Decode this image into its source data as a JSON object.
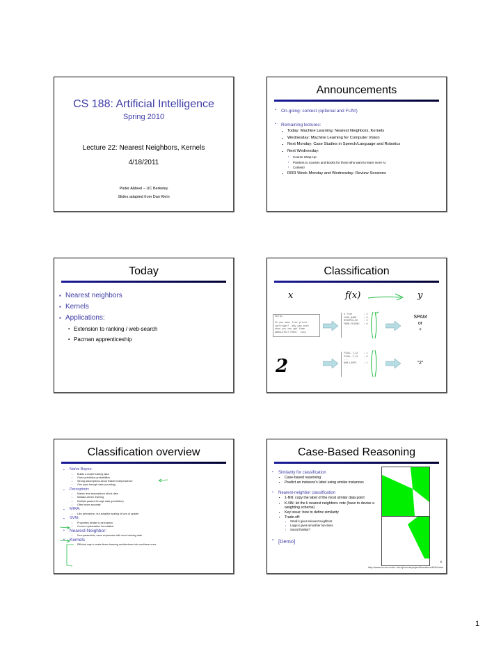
{
  "page_number": "1",
  "colors": {
    "title_blue": "#3c3ca6",
    "rule_start": "#1a1a9a",
    "rule_end": "#000030",
    "annotation_green": "#22bb44",
    "knn_green": "#00ee00",
    "arrow_fill": "#b5dde3"
  },
  "slides": [
    {
      "id": "title-slide",
      "course": "CS 188: Artificial Intelligence",
      "term": "Spring 2010",
      "lecture": "Lecture 22: Nearest Neighbors, Kernels",
      "date": "4/18/2011",
      "author": "Pieter Abbeel – UC Berkeley",
      "credit": "Slides adapted from Dan Klein"
    },
    {
      "id": "announcements",
      "title": "Announcements",
      "items": [
        {
          "text": "On-going: contest (optional and FUN!)"
        },
        {
          "text": "Remaining lectures:",
          "children": [
            {
              "text": "Today: Machine Learning: Nearest Neighbors, Kernels"
            },
            {
              "text": "Wednesday: Machine Learning for Computer Vision"
            },
            {
              "text": "Next Monday: Case Studies in Speech/Language and Robotics"
            },
            {
              "text": "Next Wednesday:",
              "children": [
                {
                  "text": "Course Wrap-Up"
                },
                {
                  "text": "Pointers to courses and Books for those who want to learn more AI"
                },
                {
                  "text": "Contest!"
                }
              ]
            },
            {
              "text": "RRR Week Monday and Wednesday: Review Sessions"
            }
          ]
        }
      ]
    },
    {
      "id": "today",
      "title": "Today",
      "items": [
        {
          "text": "Nearest neighbors"
        },
        {
          "text": "Kernels"
        },
        {
          "text": "Applications:",
          "children": [
            {
              "text": "Extension to ranking / web-search"
            },
            {
              "text": "Pacman apprenticeship"
            }
          ]
        }
      ]
    },
    {
      "id": "classification",
      "title": "Classification",
      "headers": {
        "x": "x",
        "fx": "f(x)",
        "y": "y"
      },
      "email_text": [
        "Hello,",
        "",
        "Do you want free printr",
        "cartriges?  Why pay more",
        "when you can get them",
        "ABSOLUTELY FREE!  Just"
      ],
      "email_features": [
        "# free        : 2",
        "YOUR_NAME     : 0",
        "MISSPELLED    : 2",
        "FROM_FRIEND   : 0",
        "..."
      ],
      "email_output": [
        "SPAM",
        "or",
        "+"
      ],
      "digit": "2",
      "digit_features": [
        "PIXEL-7,12    : 1",
        "PIXEL-7,13    : 0",
        "...",
        "NUM_LOOPS     : 1",
        "..."
      ],
      "digit_output": "“2”"
    },
    {
      "id": "classification-overview",
      "title": "Classification overview",
      "items": [
        {
          "text": "Naïve Bayes:",
          "children": [
            "Builds a model training data",
            "Gives prediction probabilities",
            "Strong assumptions about feature independence",
            "One pass through data (counting)"
          ]
        },
        {
          "text": "Perceptron:",
          "children": [
            "Makes less assumptions about data",
            "Mistake-driven learning",
            "Multiple passes through data (prediction)",
            "Often more accurate"
          ]
        },
        {
          "text": "MIRA:",
          "children": [
            "Like perceptron, but adaptive scaling of size of update"
          ]
        },
        {
          "text": "SVM:",
          "children": [
            "Properties similar to perceptron",
            "Convex optimization formulation"
          ]
        },
        {
          "text": "Nearest-Neighbor:",
          "children": [
            "Non-parametric; more expressive with more training data"
          ]
        },
        {
          "text": "Kernels",
          "children": [
            "Efficient way to make linear learning architectures into nonlinear ones"
          ]
        }
      ]
    },
    {
      "id": "case-based-reasoning",
      "title": "Case-Based Reasoning",
      "items": [
        {
          "text": "Similarity for classification",
          "children": [
            {
              "text": "Case-based reasoning"
            },
            {
              "text": "Predict an instance’s label using similar instances"
            }
          ]
        },
        {
          "text": "Nearest-neighbor classification",
          "children": [
            {
              "text": "1-NN: copy the label of the most similar data point"
            },
            {
              "text": "K-NN: let the k nearest neighbors vote (have to devise a weighting scheme)"
            },
            {
              "text": "Key issue: how to define similarity"
            },
            {
              "text": "Trade-off:",
              "children": [
                "Small k gives relevant neighbors",
                "Large k gives smoother functions",
                "Sound familiar?"
              ]
            }
          ]
        }
      ],
      "demo": "[Demo]",
      "slide_number": "6",
      "url": "http://www.cs.cmu.edu/~zhuxj/courseproject/knndemo/KNN.html"
    }
  ]
}
